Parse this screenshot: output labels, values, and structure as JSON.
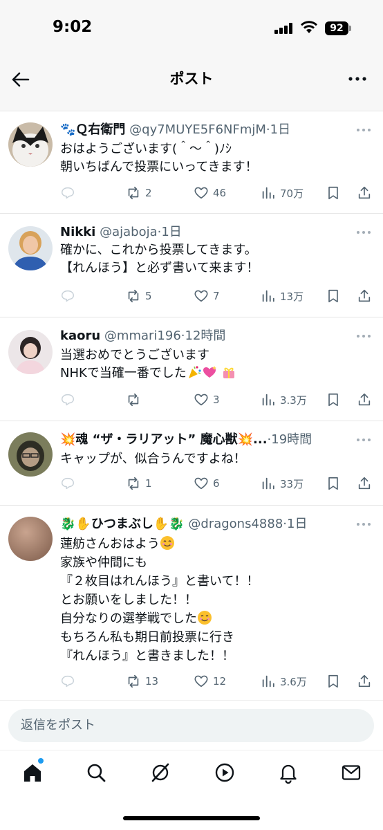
{
  "status_bar": {
    "time": "9:02",
    "battery": "92"
  },
  "header": {
    "title": "ポスト"
  },
  "posts": [
    {
      "name": "🐾Ｑ右衛門",
      "handle": "@qy7MUYE5F6NFmjM",
      "time": "·1日",
      "lines": [
        "おはようございます(＾～＾)ﾉｼ",
        "朝いちばんで投票にいってきます！"
      ],
      "reposts": "2",
      "likes": "46",
      "views": "70万"
    },
    {
      "name": "Nikki",
      "handle": "@ajaboja",
      "time": "·1日",
      "lines": [
        "確かに、これから投票してきます。",
        "【れんほう】と必ず書いて来ます！"
      ],
      "reposts": "5",
      "likes": "7",
      "views": "13万"
    },
    {
      "name": "kaoru",
      "handle": "@mmari196",
      "time": "·12時間",
      "lines": [
        "当選おめでとうございます",
        "NHKで当確一番でした"
      ],
      "reposts": "",
      "likes": "3",
      "views": "3.3万"
    },
    {
      "name": "💥魂 “ザ・ラリアット” 魔心獣💥...",
      "handle": "",
      "time": "·19時間",
      "lines": [
        "キャップが、似合うんですよね！"
      ],
      "reposts": "1",
      "likes": "6",
      "views": "33万"
    },
    {
      "name": "🐉✋ひつまぶし✋🐉",
      "handle": "@dragons4888",
      "time": "·1日",
      "lines": [
        "蓮舫さんおはよう",
        "家族や仲間にも",
        "『２枚目はれんほう』と書いて！！",
        "とお願いをしました！！",
        "自分なりの選挙戦でした",
        "もちろん私も期日前投票に行き",
        "『れんほう』と書きました！！"
      ],
      "reposts": "13",
      "likes": "12",
      "views": "3.6万"
    }
  ],
  "reply": {
    "placeholder": "返信をポスト"
  },
  "colors": {
    "accent": "#1d9bf0",
    "muted": "#536471",
    "text": "#0f1419"
  }
}
